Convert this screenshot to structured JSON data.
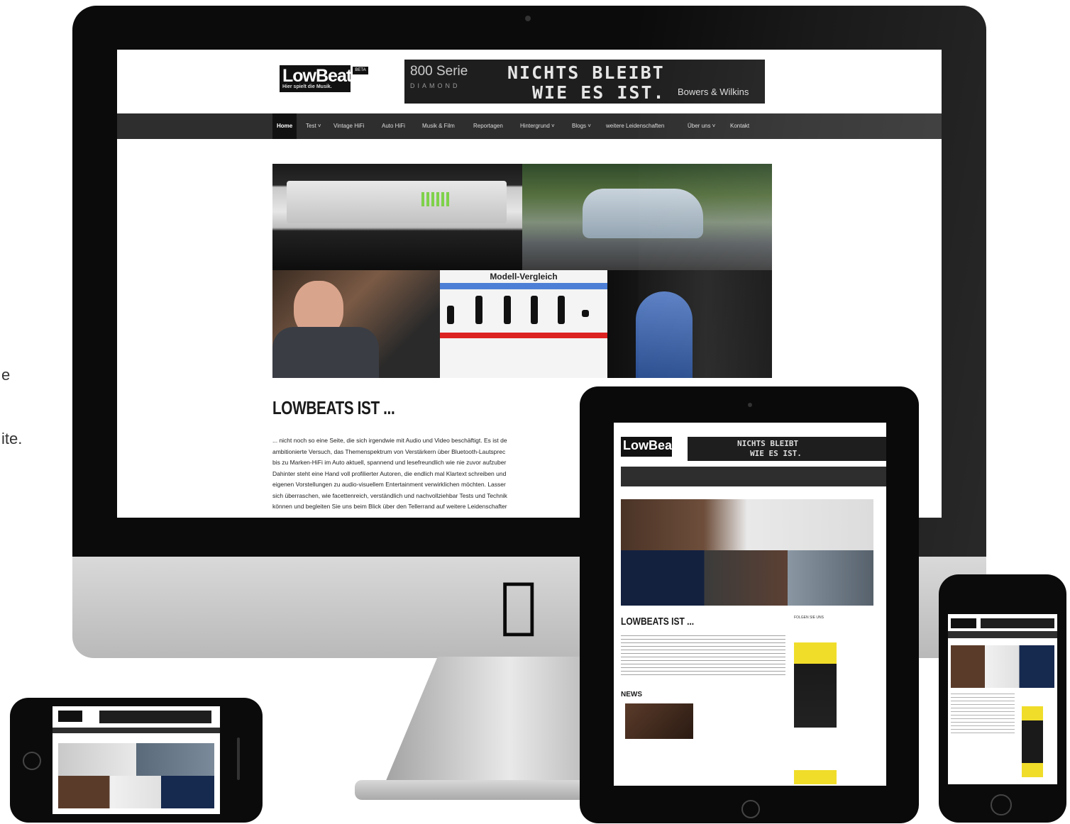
{
  "page": {
    "side_text_1": "e",
    "side_text_2": "ite."
  },
  "site": {
    "logo_text": "LowBeats",
    "logo_tagline": "Hier spielt die Musik.",
    "logo_badge": "BETA",
    "banner": {
      "series": "800 Serie",
      "diamond": "DIAMOND",
      "headline_1": "NICHTS BLEIBT",
      "headline_2": "WIE ES IST.",
      "brand": "Bowers & Wilkins"
    },
    "nav": [
      "Home",
      "Test ˅",
      "Vintage HiFi",
      "Auto HiFi",
      "Musik & Film",
      "Reportagen",
      "Hintergrund ˅",
      "Blogs ˅",
      "weitere Leidenschaften",
      "Über uns ˅",
      "Kontakt"
    ],
    "compare_title": "Modell-Vergleich",
    "main_title": "LOWBEATS IST ...",
    "main_text": [
      "... nicht noch so eine Seite, die sich irgendwie mit Audio und Video beschäftigt. Es ist de",
      "ambitionierte Versuch, das Themenspektrum von Verstärkern über Bluetooth-Lautsprec",
      "bis zu Marken-HiFi im Auto aktuell, spannend und lesefreundlich wie nie zuvor aufzuber",
      "Dahinter steht eine Hand voll profilierter Autoren, die endlich mal Klartext schreiben und",
      "eigenen Vorstellungen zu audio-visuellem Entertainment verwirklichen möchten. Lasser",
      "sich überraschen, wie facettenreich, verständlich und nachvollziehbar Tests und Technik",
      "können und begleiten Sie uns beim Blick über den Tellerrand auf weitere Leidenschafter"
    ]
  },
  "ipad": {
    "logo_text": "LowBeats",
    "banner_1": "NICHTS BLEIBT",
    "banner_2": "WIE ES IST.",
    "title": "LOWBEATS IST ...",
    "news_heading": "NEWS",
    "follow_label": "FOLGEN SIE UNS"
  }
}
